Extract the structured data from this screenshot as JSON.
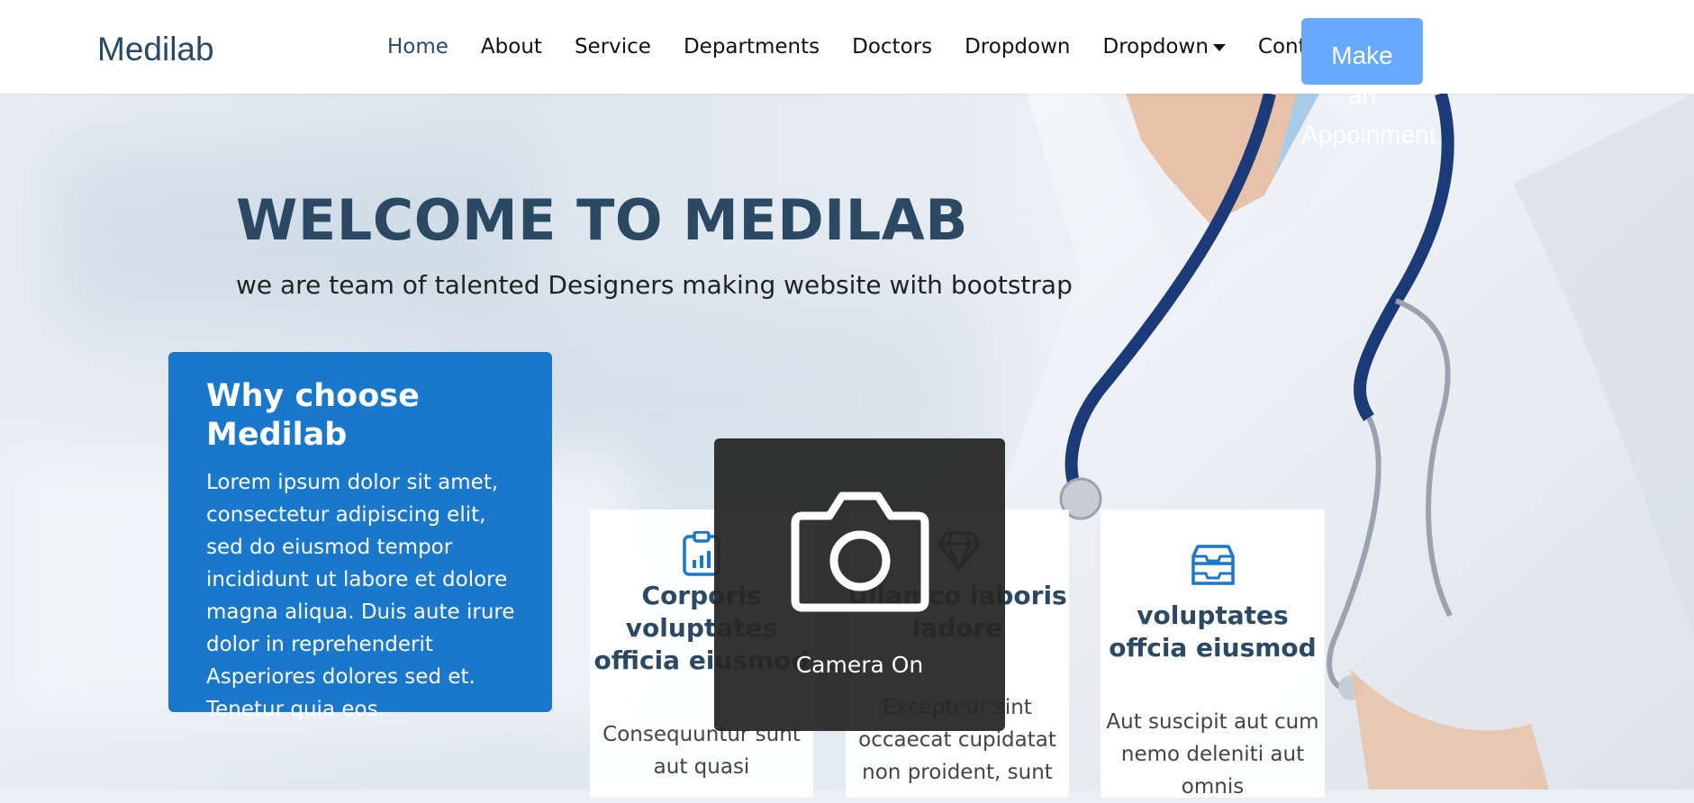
{
  "header": {
    "logo": "Medilab",
    "nav": [
      {
        "label": "Home"
      },
      {
        "label": "About"
      },
      {
        "label": "Service"
      },
      {
        "label": "Departments"
      },
      {
        "label": "Doctors"
      },
      {
        "label": "Dropdown"
      },
      {
        "label": "Dropdown"
      },
      {
        "label": "Contact"
      }
    ],
    "appointment_lines": [
      "Make",
      "an",
      "Appoinment"
    ]
  },
  "hero": {
    "title": "WELCOME TO MEDILAB",
    "subtitle": "we are team of talented Designers making website with bootstrap"
  },
  "why": {
    "title": "Why choose Medilab",
    "text": "Lorem ipsum dolor sit amet, consectetur adipiscing elit, sed do eiusmod tempor incididunt ut labore et dolore magna aliqua. Duis aute irure dolor in reprehenderit Asperiores dolores sed et. Tenetur quia eos."
  },
  "cards": [
    {
      "icon": "clipboard-chart-icon",
      "title": "Corporis voluptates officia eiusmod",
      "text": "Consequuntur sunt aut quasi"
    },
    {
      "icon": "gem-icon",
      "title": "Ullamco laboris ladore",
      "text": "Excepteur sint occaecat cupidatat non proident, sunt"
    },
    {
      "icon": "inbox-icon",
      "title": "voluptates offcia eiusmod",
      "text": "Aut suscipit aut cum nemo deleniti aut omnis"
    }
  ],
  "camera": {
    "icon": "camera-icon",
    "label": "Camera On"
  },
  "colors": {
    "primary": "#1977cc",
    "heading": "#2c4964",
    "button": "#66a9ff"
  }
}
